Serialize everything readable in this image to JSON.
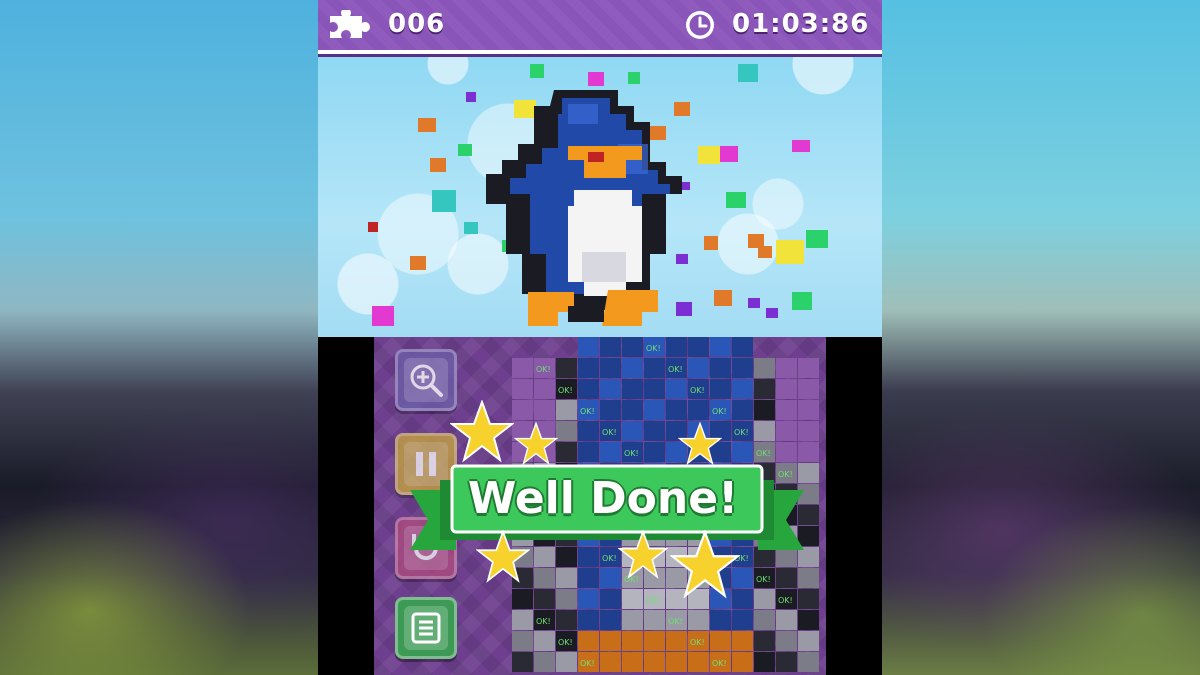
{
  "hud": {
    "puzzle_icon": "puzzle-piece-icon",
    "puzzle_count": "006",
    "clock_icon": "clock-icon",
    "timer": "01:03:86"
  },
  "top_screen": {
    "subject": "penguin voxel model",
    "background_color": "#a3dcf4"
  },
  "side_buttons": [
    {
      "name": "zoom-button",
      "icon": "magnifier-plus-icon",
      "color": "#6c5ea8"
    },
    {
      "name": "pause-button",
      "icon": "pause-icon",
      "color": "#c9a83a"
    },
    {
      "name": "undo-button",
      "icon": "undo-icon",
      "color": "#b04b7d"
    },
    {
      "name": "menu-button",
      "icon": "list-icon",
      "color": "#3d9a55"
    }
  ],
  "grid": {
    "cell_label": "OK!"
  },
  "celebration": {
    "message": "Well Done!",
    "banner_color": "#2fb84a",
    "star_color": "#f7d22c"
  }
}
